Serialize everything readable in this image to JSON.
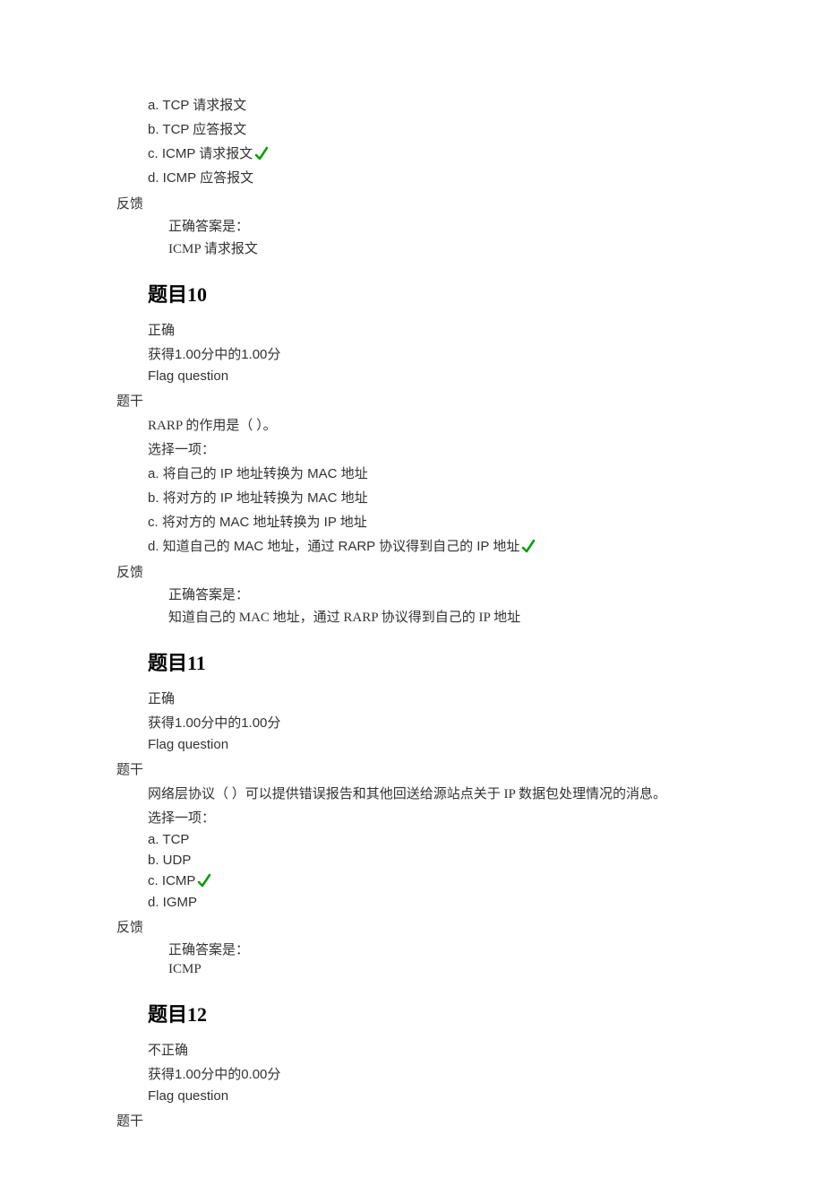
{
  "labels": {
    "feedback": "反馈",
    "correctAnswerIs": "正确答案是：",
    "stem": "题干",
    "selectOne": "选择一项：",
    "flagQuestion": "Flag question"
  },
  "topBlock": {
    "options": [
      "a. TCP 请求报文",
      "b. TCP 应答报文",
      "c. ICMP  请求报文",
      "d. ICMP 应答报文"
    ],
    "correctIndex": 2,
    "answer": "ICMP  请求报文"
  },
  "q10": {
    "title": "题目10",
    "status": "正确",
    "score": "获得1.00分中的1.00分",
    "stem": "RARP 的作用是（   ）。",
    "options": [
      "a.  将自己的 IP 地址转换为 MAC 地址",
      "b.  将对方的 IP 地址转换为 MAC 地址",
      "c.  将对方的 MAC 地址转换为 IP 地址",
      "d.  知道自己的 MAC 地址，通过 RARP 协议得到自己的 IP 地址"
    ],
    "correctIndex": 3,
    "answer": "知道自己的 MAC 地址，通过 RARP 协议得到自己的 IP 地址"
  },
  "q11": {
    "title": "题目11",
    "status": "正确",
    "score": "获得1.00分中的1.00分",
    "stem": "网络层协议（   ）可以提供错误报告和其他回送给源站点关于 IP 数据包处理情况的消息。",
    "options": [
      "a. TCP",
      "b. UDP",
      "c. ICMP",
      "d. IGMP"
    ],
    "correctIndex": 2,
    "answer": "ICMP"
  },
  "q12": {
    "title": "题目12",
    "status": "不正确",
    "score": "获得1.00分中的0.00分"
  }
}
